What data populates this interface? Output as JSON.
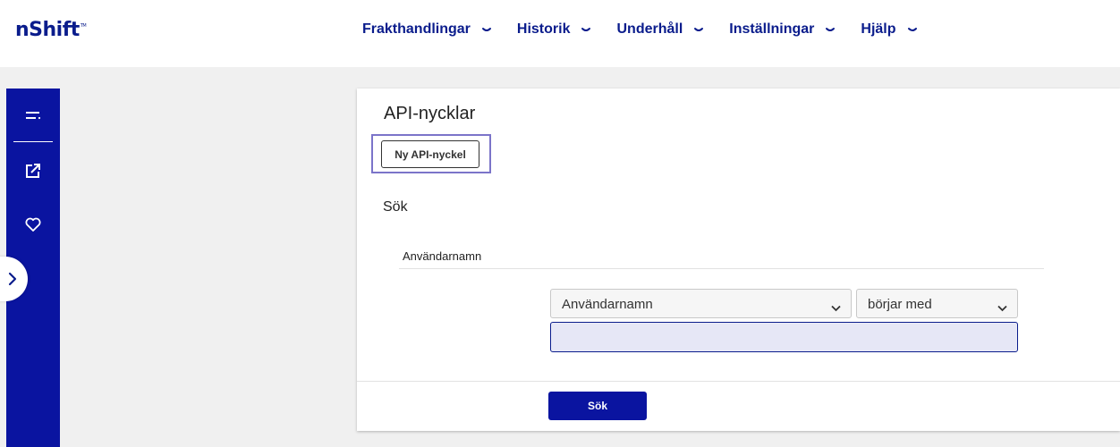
{
  "brand": {
    "name": "nShift",
    "trademark": "TM",
    "color": "#0a1c8c"
  },
  "nav": {
    "items": [
      {
        "label": "Frakthandlingar",
        "icon": "chevron-down-icon"
      },
      {
        "label": "Historik",
        "icon": "chevron-down-icon"
      },
      {
        "label": "Underhåll",
        "icon": "chevron-down-icon"
      },
      {
        "label": "Inställningar",
        "icon": "chevron-down-icon"
      },
      {
        "label": "Hjälp",
        "icon": "chevron-down-icon"
      }
    ]
  },
  "sidebar": {
    "color": "#0a14a0",
    "icons": [
      "menu-collapse-icon",
      "share-icon",
      "favorites-heart-icon"
    ],
    "expand_icon": "chevron-right-icon"
  },
  "page": {
    "title": "API-nycklar",
    "new_key_button": "Ny API-nyckel",
    "search_heading": "Sök",
    "field_label": "Användarnamn",
    "field_select": {
      "selected": "Användarnamn"
    },
    "operator_select": {
      "selected": "börjar med"
    },
    "search_input": {
      "value": "",
      "placeholder": ""
    },
    "search_button": "Sök"
  },
  "colors": {
    "accent": "#0a14a0",
    "focus_ring": "#7b74c9",
    "input_background": "#e6e7f6"
  }
}
